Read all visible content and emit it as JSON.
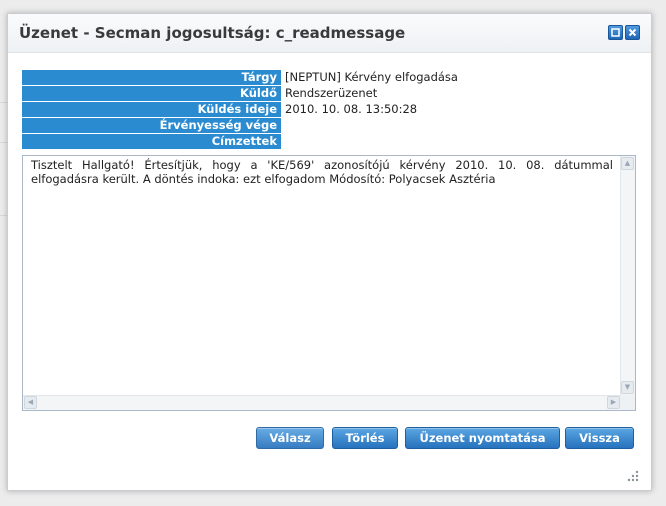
{
  "dialog": {
    "title": "Üzenet - Secman jogosultság: c_readmessage"
  },
  "fields": [
    {
      "label": "Tárgy",
      "value": "[NEPTUN] Kérvény elfogadása"
    },
    {
      "label": "Küldő",
      "value": "Rendszerüzenet"
    },
    {
      "label": "Küldés ideje",
      "value": "2010. 10. 08. 13:50:28"
    },
    {
      "label": "Érvényesség vége",
      "value": ""
    },
    {
      "label": "Címzettek",
      "value": ""
    }
  ],
  "message": {
    "body": "Tisztelt Hallgató! Értesítjük, hogy a 'KE/569' azonosítójú kérvény 2010. 10. 08. dátummal elfogadásra került. A döntés indoka: ezt elfogadom Módosító: Polyacsek Asztéria"
  },
  "buttons": {
    "reply": "Válasz",
    "delete": "Törlés",
    "print": "Üzenet nyomtatása",
    "back": "Vissza"
  },
  "colors": {
    "label_bg": "#2b8bd0",
    "button_bg": "#2672bd",
    "titlebar_button": "#1f66b4"
  },
  "icons": {
    "maximize": "maximize-icon",
    "close": "close-icon",
    "resize": "resize-grip-icon"
  }
}
